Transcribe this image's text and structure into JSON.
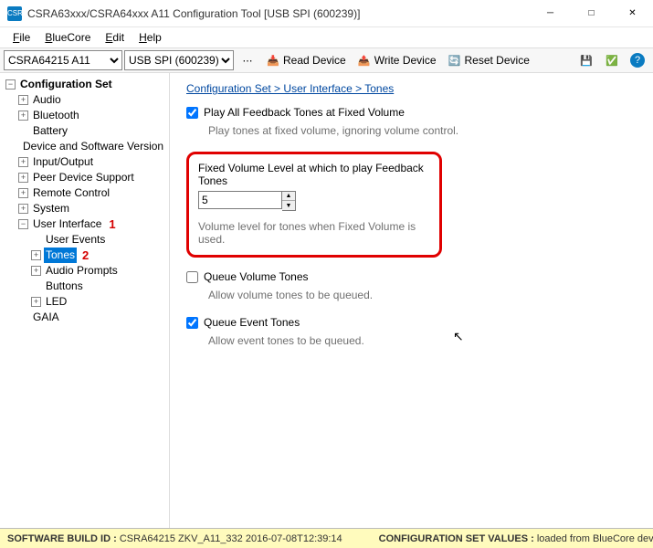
{
  "window": {
    "title": "CSRA63xxx/CSRA64xxx A11 Configuration Tool [USB SPI (600239)]",
    "appicon_text": "CSR"
  },
  "menu": {
    "file": "File",
    "bluecore": "BlueCore",
    "edit": "Edit",
    "help": "Help"
  },
  "toolbar": {
    "chip_sel": "CSRA64215 A11",
    "transport_sel": "USB SPI (600239)",
    "read_device": "Read Device",
    "write_device": "Write Device",
    "reset_device": "Reset Device"
  },
  "tree": {
    "root": "Configuration Set",
    "items": {
      "audio": "Audio",
      "bluetooth": "Bluetooth",
      "battery": "Battery",
      "device_sw": "Device and Software Version",
      "input_output": "Input/Output",
      "peer_device": "Peer Device Support",
      "remote_control": "Remote Control",
      "system": "System",
      "user_interface": "User Interface",
      "gaia": "GAIA",
      "user_events": "User Events",
      "tones": "Tones",
      "audio_prompts": "Audio Prompts",
      "buttons": "Buttons",
      "led": "LED"
    },
    "ann1": "1",
    "ann2": "2"
  },
  "content": {
    "breadcrumb": "Configuration Set > User Interface > Tones",
    "play_all": {
      "label": "Play All Feedback Tones at Fixed Volume",
      "desc": "Play tones at fixed volume, ignoring volume control.",
      "checked": true
    },
    "fixed_vol": {
      "label": "Fixed Volume Level at which to play Feedback Tones",
      "value": "5",
      "desc": "Volume level for tones when Fixed Volume is used."
    },
    "queue_vol": {
      "label": "Queue Volume Tones",
      "desc": "Allow volume tones to be queued.",
      "checked": false
    },
    "queue_evt": {
      "label": "Queue Event Tones",
      "desc": "Allow event tones to be queued.",
      "checked": true
    }
  },
  "status": {
    "build_label": "SOFTWARE BUILD ID :",
    "build_value": "CSRA64215 ZKV_A11_332 2016-07-08T12:39:14",
    "config_label": "CONFIGURATION SET VALUES :",
    "config_value": "loaded from BlueCore device"
  }
}
